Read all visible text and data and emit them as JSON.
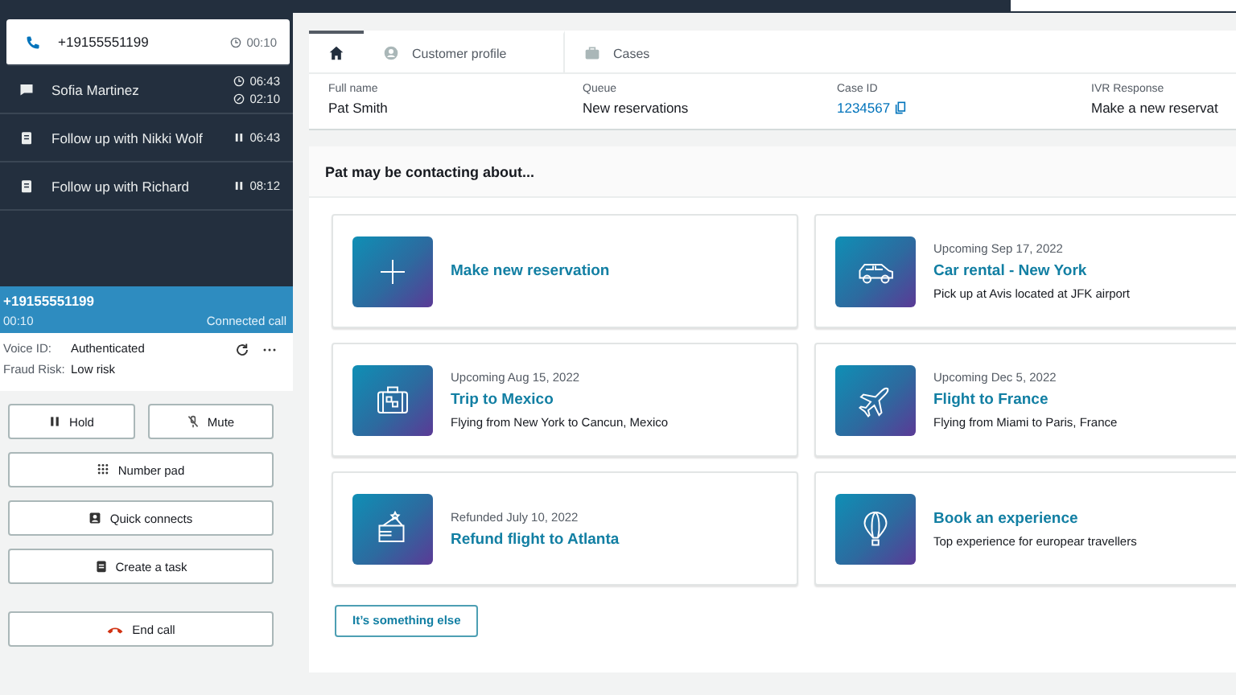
{
  "contacts": [
    {
      "kind": "call",
      "name": "+19155551199",
      "selected": true,
      "times": [
        {
          "kind": "clock",
          "value": "00:10"
        }
      ]
    },
    {
      "kind": "chat",
      "name": "Sofia Martinez",
      "selected": false,
      "times": [
        {
          "kind": "clock",
          "value": "06:43"
        },
        {
          "kind": "timer",
          "value": "02:10"
        }
      ]
    },
    {
      "kind": "task",
      "name": "Follow up with Nikki Wolf",
      "selected": false,
      "times": [
        {
          "kind": "paused",
          "value": "06:43"
        }
      ]
    },
    {
      "kind": "task",
      "name": "Follow up with Richard",
      "selected": false,
      "times": [
        {
          "kind": "paused",
          "value": "08:12"
        }
      ]
    }
  ],
  "active_call": {
    "number": "+19155551199",
    "timer": "00:10",
    "status": "Connected call",
    "details": [
      {
        "label": "Voice ID:",
        "value": "Authenticated"
      },
      {
        "label": "Fraud Risk:",
        "value": "Low risk"
      }
    ]
  },
  "controls": [
    [
      {
        "kind": "hold",
        "label": "Hold"
      },
      {
        "kind": "mute",
        "label": "Mute"
      }
    ],
    [
      {
        "kind": "keypad",
        "label": "Number pad"
      }
    ],
    [
      {
        "kind": "contacts",
        "label": "Quick connects"
      }
    ],
    [
      {
        "kind": "task",
        "label": "Create a task"
      }
    ],
    [
      {
        "kind": "end",
        "label": "End call"
      }
    ]
  ],
  "tabs": [
    {
      "kind": "home",
      "selected": true
    },
    {
      "kind": "profile",
      "label": "Customer profile",
      "selected": false
    },
    {
      "kind": "cases",
      "label": "Cases",
      "selected": false
    }
  ],
  "fields": [
    {
      "kind": "text",
      "label": "Full name",
      "value": "Pat Smith"
    },
    {
      "kind": "text",
      "label": "Queue",
      "value": "New reservations"
    },
    {
      "kind": "link",
      "label": "Case ID",
      "value": "1234567"
    },
    {
      "kind": "text",
      "label": "IVR Response",
      "value": "Make a new reservat"
    }
  ],
  "section": {
    "heading": "Pat may be contacting about...",
    "action": "It’s something else"
  },
  "new_reservation": {
    "title": "Make new reservation"
  },
  "cards": [
    {
      "kind": "car",
      "caption": "Upcoming Sep 17, 2022",
      "title": "Car rental - New York",
      "description": "Pick up at Avis located at JFK airport"
    },
    {
      "kind": "suitcase",
      "caption": "Upcoming Aug 15, 2022",
      "title": "Trip to Mexico",
      "description": "Flying from New York to Cancun, Mexico"
    },
    {
      "kind": "plane",
      "caption": "Upcoming Dec 5, 2022",
      "title": "Flight to France",
      "description": "Flying from Miami to Paris, France"
    },
    {
      "kind": "wallet",
      "caption": "Refunded July 10, 2022",
      "title": "Refund flight to Atlanta"
    },
    {
      "kind": "balloon",
      "title": "Book an experience",
      "description": "Top experience for europear travellers"
    }
  ]
}
